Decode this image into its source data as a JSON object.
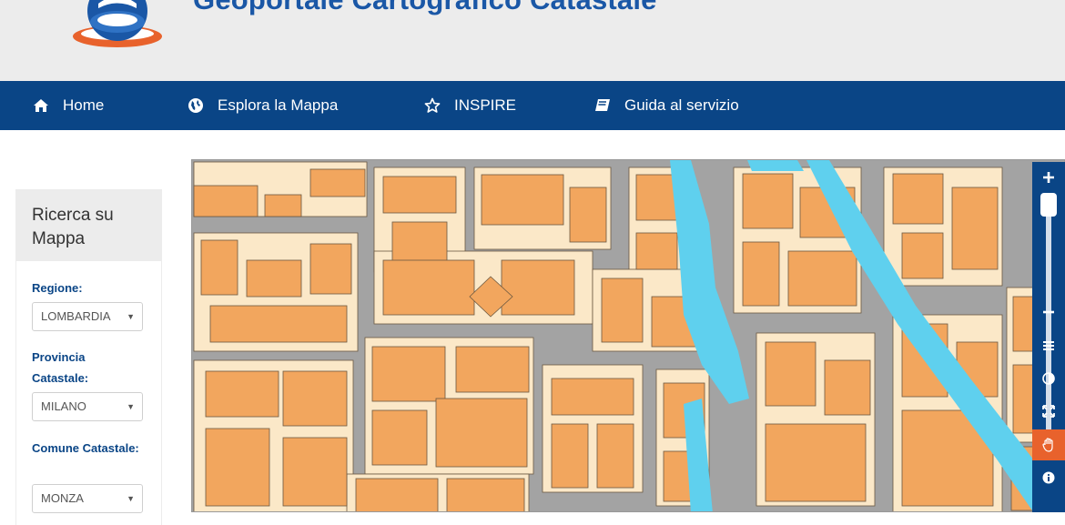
{
  "header": {
    "site_title": "Geoportale Cartografico Catastale"
  },
  "nav": {
    "items": [
      {
        "label": "Home",
        "icon": "home-icon"
      },
      {
        "label": "Esplora la Mappa",
        "icon": "globe-icon"
      },
      {
        "label": "INSPIRE",
        "icon": "star-icon"
      },
      {
        "label": "Guida al servizio",
        "icon": "book-icon"
      }
    ]
  },
  "sidebar": {
    "title": "Ricerca su Mappa",
    "fields": [
      {
        "label": "Regione:",
        "value": "LOMBARDIA"
      },
      {
        "label": "Provincia Catastale:",
        "value": "MILANO"
      },
      {
        "label": "Comune Catastale:",
        "value": "MONZA"
      }
    ]
  },
  "map_toolbar": {
    "tools": [
      "zoom-in-icon",
      "zoom-out-icon",
      "layers-icon",
      "contrast-icon",
      "fullscreen-icon",
      "pan-hand-icon",
      "info-icon"
    ],
    "active_tool": "pan-hand-icon"
  },
  "colors": {
    "nav_bg": "#0a4586",
    "title": "#1a57a6",
    "accent": "#e8622c",
    "map_building": "#f2a65e",
    "map_parcel": "#fbe8c8",
    "map_street": "#a3a3a3",
    "map_water": "#5fd0ee"
  }
}
